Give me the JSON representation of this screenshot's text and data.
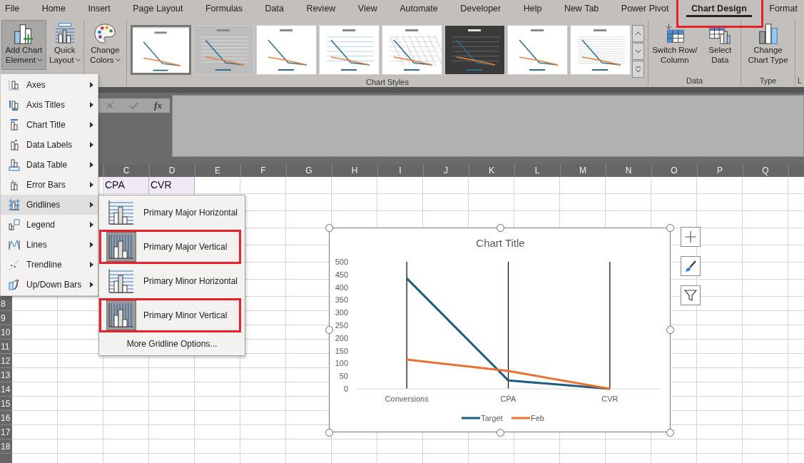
{
  "ribbon_tabs": [
    {
      "label": "File",
      "selected": false,
      "annotated": false
    },
    {
      "label": "Home",
      "selected": false,
      "annotated": false
    },
    {
      "label": "Insert",
      "selected": false,
      "annotated": false
    },
    {
      "label": "Page Layout",
      "selected": false,
      "annotated": false
    },
    {
      "label": "Formulas",
      "selected": false,
      "annotated": false
    },
    {
      "label": "Data",
      "selected": false,
      "annotated": false
    },
    {
      "label": "Review",
      "selected": false,
      "annotated": false
    },
    {
      "label": "View",
      "selected": false,
      "annotated": false
    },
    {
      "label": "Automate",
      "selected": false,
      "annotated": false
    },
    {
      "label": "Developer",
      "selected": false,
      "annotated": false
    },
    {
      "label": "Help",
      "selected": false,
      "annotated": false
    },
    {
      "label": "New Tab",
      "selected": false,
      "annotated": false
    },
    {
      "label": "Power Pivot",
      "selected": false,
      "annotated": false
    },
    {
      "label": "Chart Design",
      "selected": true,
      "annotated": true
    },
    {
      "label": "Format",
      "selected": false,
      "annotated": false
    }
  ],
  "ribbon_groups": [
    {
      "kind": "buttons",
      "buttons": [
        {
          "line1": "Add Chart",
          "line2": "Element",
          "pressed": true,
          "dropdown": true
        },
        {
          "line1": "Quick",
          "line2": "Layout",
          "pressed": false,
          "dropdown": true
        }
      ]
    },
    {
      "kind": "buttons",
      "buttons": [
        {
          "line1": "Change",
          "line2": "Colors",
          "pressed": false,
          "dropdown": true
        }
      ]
    },
    {
      "kind": "gallery",
      "label": "Chart Styles",
      "styles": [
        {
          "kind": "light",
          "selected": true
        },
        {
          "kind": "gray",
          "selected": false
        },
        {
          "kind": "light",
          "selected": false
        },
        {
          "kind": "blue",
          "selected": false
        },
        {
          "kind": "hatched",
          "selected": false
        },
        {
          "kind": "dark",
          "selected": false
        },
        {
          "kind": "light",
          "selected": false
        },
        {
          "kind": "lined",
          "selected": false
        }
      ]
    },
    {
      "kind": "buttons",
      "label": "Data",
      "buttons": [
        {
          "line1": "Switch Row/",
          "line2": "Column",
          "pressed": false,
          "dropdown": false
        },
        {
          "line1": "Select",
          "line2": "Data",
          "pressed": false,
          "dropdown": false
        }
      ]
    },
    {
      "kind": "buttons",
      "label": "Type",
      "buttons": [
        {
          "line1": "Change",
          "line2": "Chart Type",
          "pressed": false,
          "dropdown": false
        }
      ]
    },
    {
      "kind": "cut",
      "label": "L"
    }
  ],
  "formula_bar": {
    "function_button": "fx"
  },
  "sheet": {
    "columns": [
      "C",
      "D",
      "E",
      "F",
      "G",
      "H",
      "I",
      "J",
      "K",
      "L",
      "M",
      "N",
      "O",
      "P",
      "Q"
    ],
    "row_numbers": [
      "8",
      "9",
      "10",
      "11",
      "12",
      "13",
      "14",
      "15",
      "16",
      "17",
      "18"
    ],
    "row_1_cells": [
      {
        "value": "CPA",
        "selected": true
      },
      {
        "value": "CVR",
        "selected": true
      }
    ]
  },
  "add_chart_element_menu": [
    {
      "label": "Axes",
      "selected": false
    },
    {
      "label": "Axis Titles",
      "selected": false
    },
    {
      "label": "Chart Title",
      "selected": false
    },
    {
      "label": "Data Labels",
      "selected": false
    },
    {
      "label": "Data Table",
      "selected": false
    },
    {
      "label": "Error Bars",
      "selected": false
    },
    {
      "label": "Gridlines",
      "selected": true
    },
    {
      "label": "Legend",
      "selected": false
    },
    {
      "label": "Lines",
      "selected": false
    },
    {
      "label": "Trendline",
      "selected": false
    },
    {
      "label": "Up/Down Bars",
      "selected": false
    }
  ],
  "gridlines_submenu": {
    "items": [
      {
        "label": "Primary Major Horizontal",
        "on": false,
        "annotated": false
      },
      {
        "label": "Primary Major Vertical",
        "on": true,
        "annotated": true
      },
      {
        "label": "Primary Minor Horizontal",
        "on": false,
        "annotated": false
      },
      {
        "label": "Primary Minor Vertical",
        "on": true,
        "annotated": true
      }
    ],
    "more": "More Gridline Options..."
  },
  "chart": {
    "chart_data": {
      "type": "line",
      "title": "Chart Title",
      "categories": [
        "Conversions",
        "CPA",
        "CVR"
      ],
      "series": [
        {
          "name": "Target",
          "color": "#1b5e7e",
          "values": [
            435,
            33,
            0
          ]
        },
        {
          "name": "Feb",
          "color": "#e97132",
          "values": [
            115,
            70,
            0
          ]
        }
      ],
      "ylim": [
        0,
        500
      ],
      "yticks": [
        0,
        50,
        100,
        150,
        200,
        250,
        300,
        350,
        400,
        450,
        500
      ],
      "grid": {
        "vertical": true,
        "horizontal": false
      },
      "legend": "bottom"
    }
  }
}
